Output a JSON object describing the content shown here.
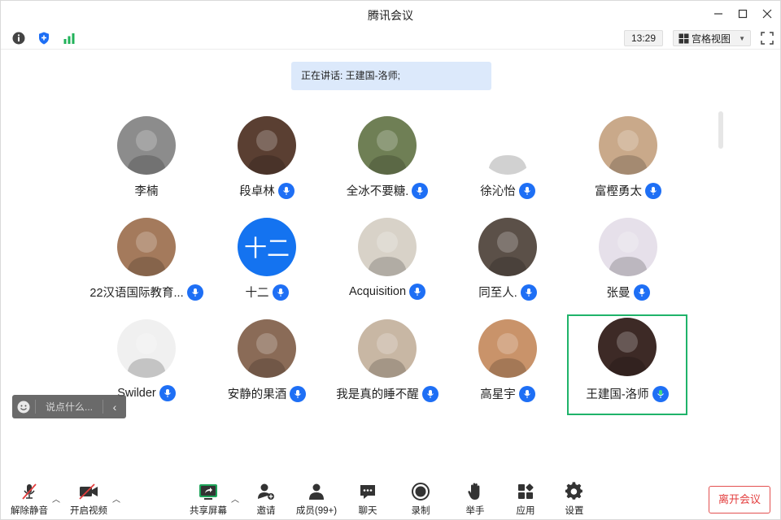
{
  "window": {
    "title": "腾讯会议"
  },
  "toolbar": {
    "time": "13:29",
    "view_label": "宫格视图",
    "icons": [
      "info-icon",
      "shield-icon",
      "signal-icon"
    ]
  },
  "speaking": {
    "text": "正在讲话: 王建国-洛师;"
  },
  "participants": [
    {
      "name": "李楠",
      "mic": false,
      "avatar_bg": "#8c8c8c"
    },
    {
      "name": "段卓林",
      "mic": true,
      "avatar_bg": "#5a3f32"
    },
    {
      "name": "全冰不要糖.",
      "mic": true,
      "avatar_bg": "#6f7f55"
    },
    {
      "name": "徐沁怡",
      "mic": true,
      "avatar_bg": "#ffffff"
    },
    {
      "name": "富樫勇太",
      "mic": true,
      "avatar_bg": "#c9a98a"
    },
    {
      "name": "22汉语国际教育...",
      "mic": true,
      "avatar_bg": "#a47a5c"
    },
    {
      "name": "十二",
      "mic": true,
      "avatar_bg": "#1473f0",
      "avatar_text": "十二"
    },
    {
      "name": "Acquisition",
      "mic": true,
      "avatar_bg": "#d8d2c8"
    },
    {
      "name": "同至人.",
      "mic": true,
      "avatar_bg": "#5b5048"
    },
    {
      "name": "张曼",
      "mic": true,
      "avatar_bg": "#e6e0ea"
    },
    {
      "name": "Swilder",
      "mic": true,
      "avatar_bg": "#f0f0f0"
    },
    {
      "name": "安静的果酒",
      "mic": true,
      "avatar_bg": "#8a6b57"
    },
    {
      "name": "我是真的睡不醒",
      "mic": true,
      "avatar_bg": "#c8b7a4"
    },
    {
      "name": "高星宇",
      "mic": true,
      "avatar_bg": "#c9936a"
    },
    {
      "name": "王建国-洛师",
      "mic": true,
      "avatar_bg": "#3d2a26",
      "active": true
    }
  ],
  "chat": {
    "placeholder": "说点什么..."
  },
  "bottom": {
    "unmute": "解除静音",
    "video": "开启视频",
    "share": "共享屏幕",
    "invite": "邀请",
    "members": "成员(99+)",
    "chat": "聊天",
    "record": "录制",
    "raise_hand": "举手",
    "apps": "应用",
    "settings": "设置",
    "leave": "离开会议"
  },
  "colors": {
    "accent": "#1e6ff5",
    "active_border": "#1fb36a",
    "leave": "#e33d3d"
  }
}
